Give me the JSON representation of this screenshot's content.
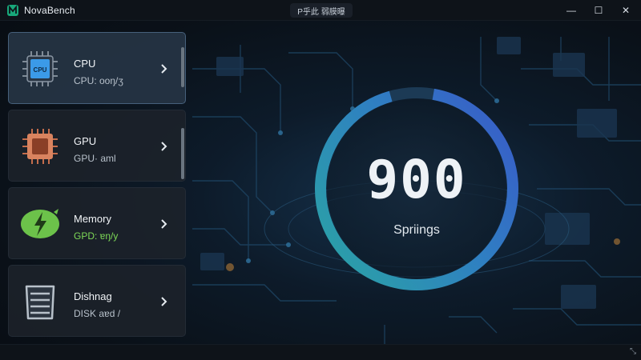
{
  "window": {
    "app_title": "NovaBench",
    "center_title": "P乎此 弱膜曝",
    "controls": {
      "minimize": "—",
      "maximize": "☐",
      "close": "✕"
    }
  },
  "sidebar": {
    "items": [
      {
        "title": "CPU",
        "subtitle": "CPU: ooŋ/ʒ",
        "icon": "cpu-chip-icon",
        "active": true
      },
      {
        "title": "GPU",
        "subtitle": "GPU· aml",
        "icon": "gpu-chip-icon",
        "active": false
      },
      {
        "title": "Memory",
        "subtitle": "GPD: ɐŋ/y",
        "icon": "memory-bolt-icon",
        "active": false
      },
      {
        "title": "Dishnag",
        "subtitle": "DISK aɐd /",
        "icon": "disk-stack-icon",
        "active": false
      }
    ]
  },
  "score": {
    "value": "900",
    "label": "Spriings"
  },
  "footer": {
    "grip": "⤡"
  },
  "colors": {
    "ring_start": "#2aa5a3",
    "ring_end": "#3a57c9",
    "cpu_icon": "#3b9ae8",
    "gpu_icon": "#d9835f",
    "memory_icon": "#6cc24a",
    "disk_icon": "#b8c1ca"
  }
}
